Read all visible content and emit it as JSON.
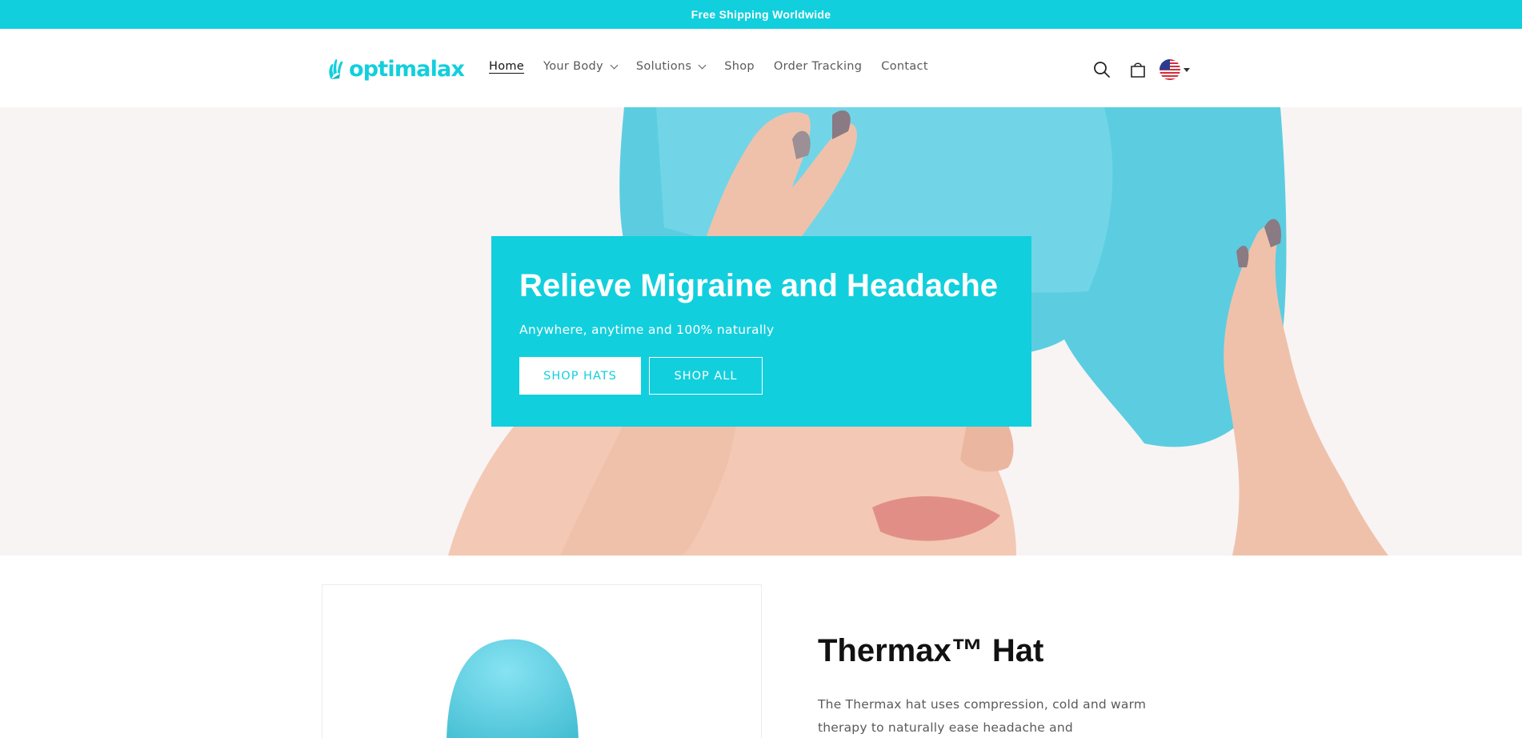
{
  "announcement": {
    "text": "Free Shipping Worldwide"
  },
  "header": {
    "logo_text": "optimalax",
    "nav": [
      {
        "label": "Home",
        "active": true,
        "has_dropdown": false
      },
      {
        "label": "Your Body",
        "active": false,
        "has_dropdown": true
      },
      {
        "label": "Solutions",
        "active": false,
        "has_dropdown": true
      },
      {
        "label": "Shop",
        "active": false,
        "has_dropdown": false
      },
      {
        "label": "Order Tracking",
        "active": false,
        "has_dropdown": false
      },
      {
        "label": "Contact",
        "active": false,
        "has_dropdown": false
      }
    ],
    "icons": [
      "search-icon",
      "cart-icon",
      "us-flag-icon"
    ]
  },
  "hero": {
    "title": "Relieve Migraine and Headache",
    "subtitle": "Anywhere, anytime and 100% naturally",
    "primary_button": "SHOP HATS",
    "secondary_button": "SHOP ALL"
  },
  "product": {
    "title": "Thermax™ Hat",
    "description": "The Thermax hat uses compression, cold and warm therapy to naturally ease headache and"
  },
  "colors": {
    "accent": "#12cfdd",
    "hero_bg": "#f8f4f4",
    "text": "#121212",
    "muted": "#5a5a5a"
  }
}
